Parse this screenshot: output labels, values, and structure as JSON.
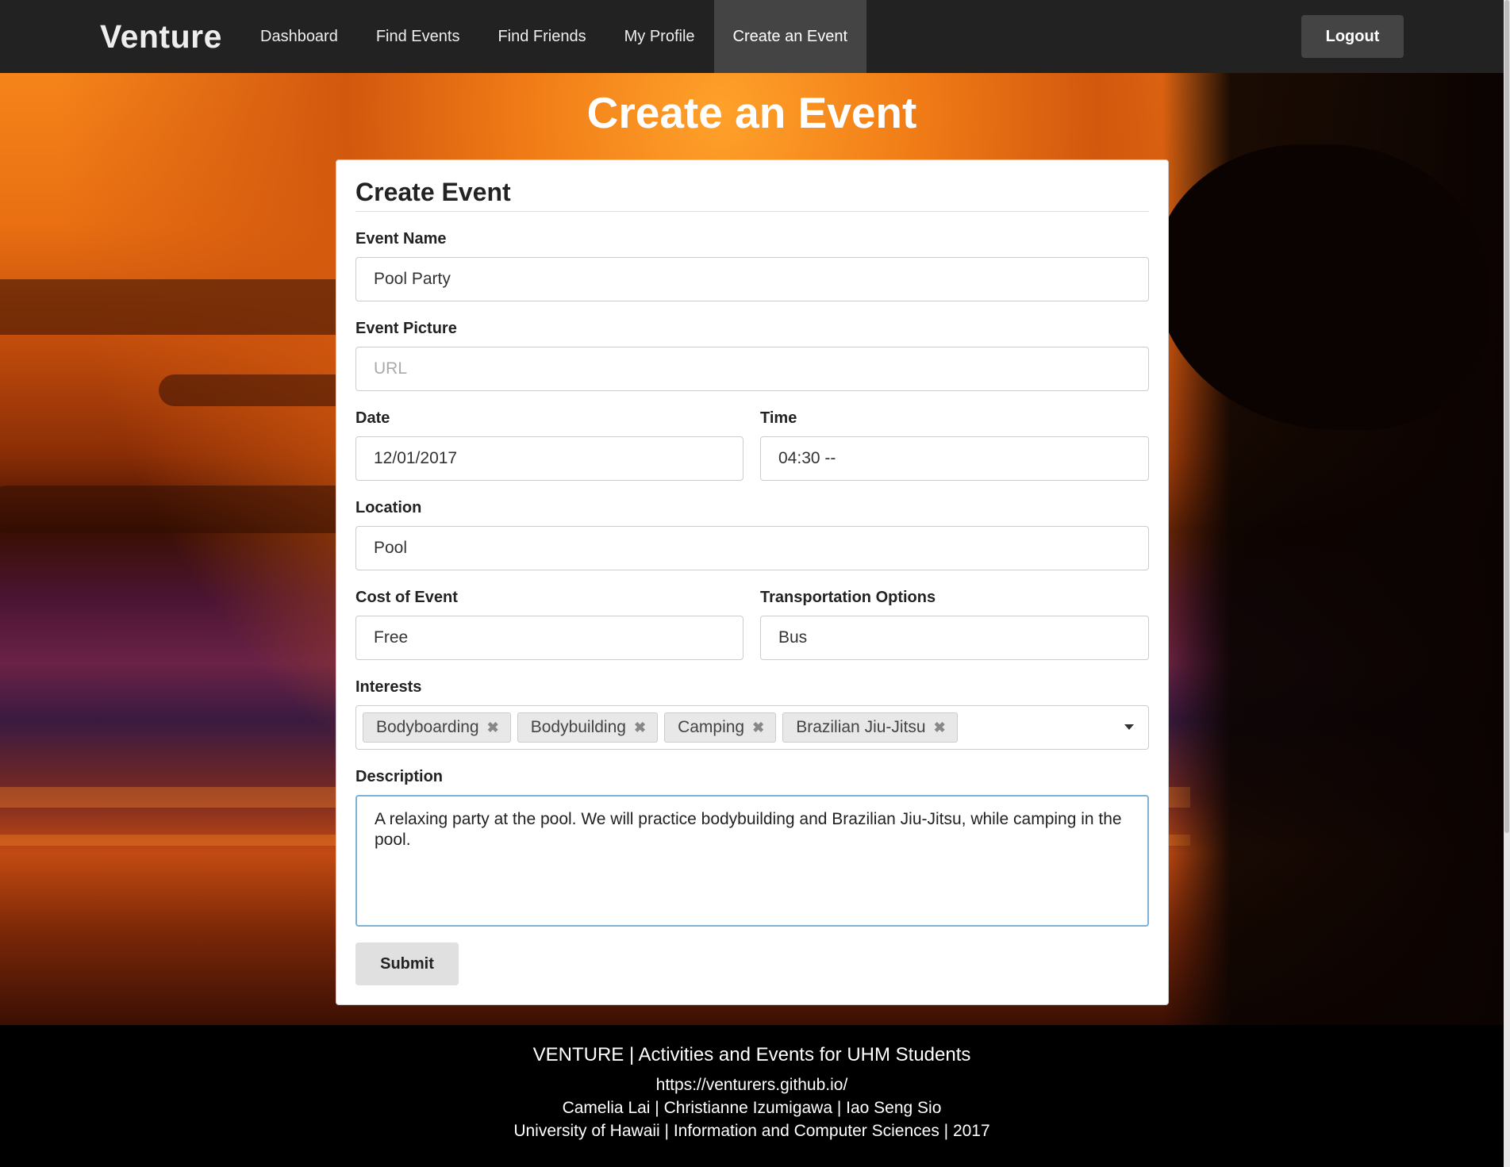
{
  "navbar": {
    "brand": "Venture",
    "links": [
      "Dashboard",
      "Find Events",
      "Find Friends",
      "My Profile",
      "Create an Event"
    ],
    "active": "Create an Event",
    "logout_label": "Logout"
  },
  "page_title": "Create an Event",
  "form": {
    "title": "Create Event",
    "event_name": {
      "label": "Event Name",
      "value": "Pool Party"
    },
    "event_picture": {
      "label": "Event Picture",
      "placeholder": "URL"
    },
    "date": {
      "label": "Date",
      "value": "12/01/2017"
    },
    "time": {
      "label": "Time",
      "value": "04:30 --"
    },
    "location": {
      "label": "Location",
      "value": "Pool"
    },
    "cost": {
      "label": "Cost of Event",
      "value": "Free"
    },
    "transportation": {
      "label": "Transportation Options",
      "value": "Bus"
    },
    "interests": {
      "label": "Interests",
      "tags": [
        "Bodyboarding",
        "Bodybuilding",
        "Camping",
        "Brazilian Jiu-Jitsu"
      ],
      "remove_glyph": "✖"
    },
    "description": {
      "label": "Description",
      "value": "A relaxing party at the pool. We will practice bodybuilding and Brazilian Jiu-Jitsu, while camping in the pool."
    },
    "submit_label": "Submit"
  },
  "footer": {
    "line1": "VENTURE | Activities and Events for UHM Students",
    "line2": "https://venturers.github.io/",
    "line3": "Camelia Lai | Christianne Izumigawa | Iao Seng Sio",
    "line4": "University of Hawaii | Information and Computer Sciences | 2017"
  },
  "colors": {
    "navbar": "#222222",
    "active_nav": "#444444",
    "logout_button": "#444444",
    "card": "#ffffff",
    "footer": "#000000",
    "textarea_focus_border": "#7fb0d6"
  }
}
